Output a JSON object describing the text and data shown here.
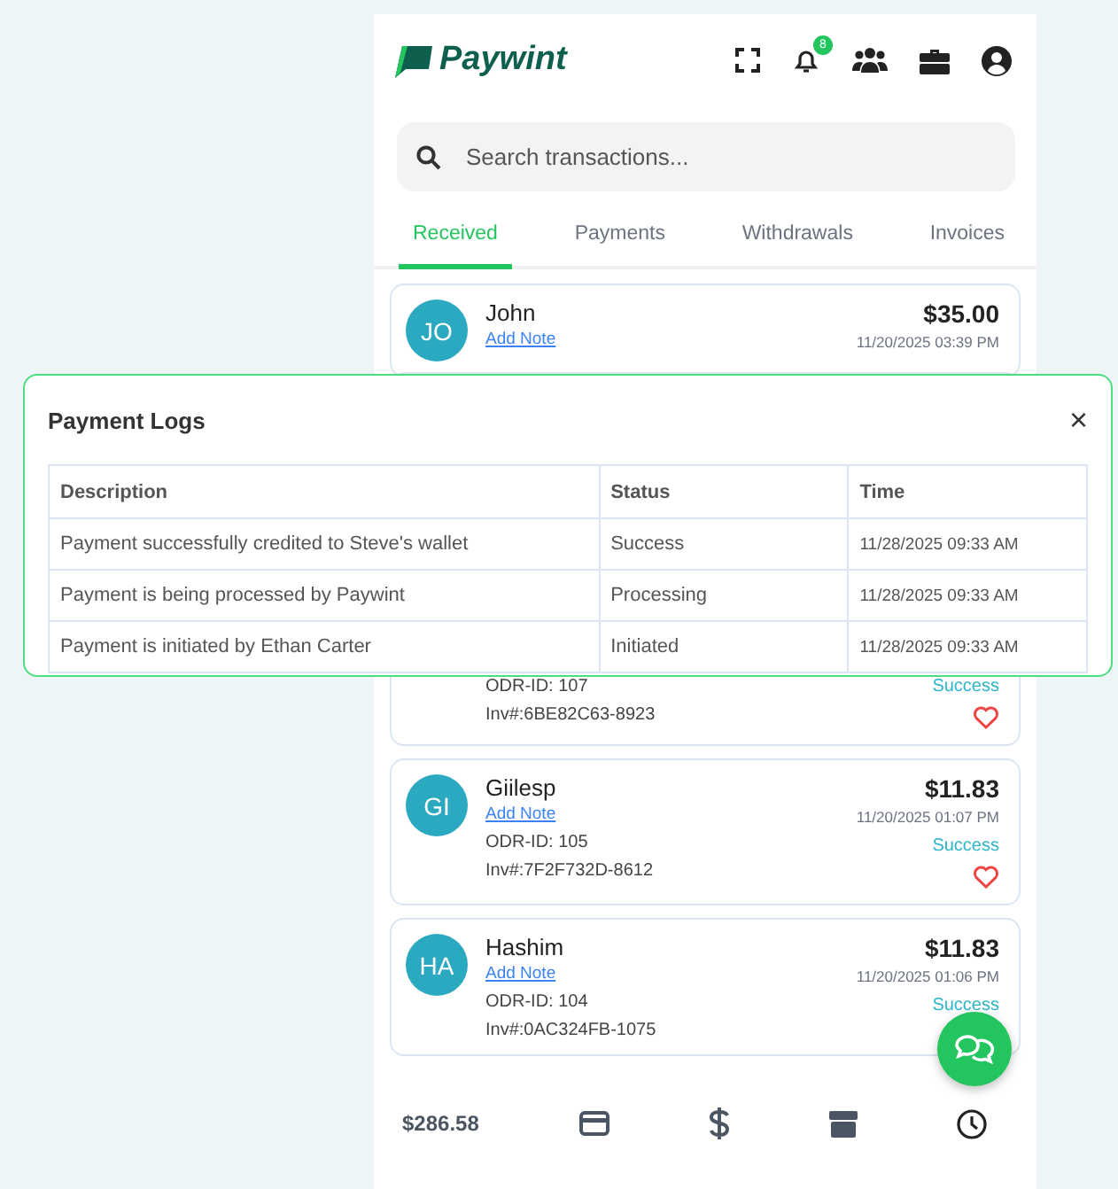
{
  "brand": {
    "name": "Paywint"
  },
  "header": {
    "notification_badge": "8"
  },
  "search": {
    "placeholder": "Search transactions..."
  },
  "tabs": [
    {
      "label": "Received",
      "selected": true
    },
    {
      "label": "Payments",
      "selected": false
    },
    {
      "label": "Withdrawals",
      "selected": false
    },
    {
      "label": "Invoices",
      "selected": false
    }
  ],
  "transactions": [
    {
      "initials": "JO",
      "name": "John",
      "note_link": "Add Note",
      "amount": "$35.00",
      "date": "11/20/2025 03:39 PM"
    },
    {
      "odr_id": "ODR-ID: 107",
      "invoice": "Inv#:6BE82C63-8923",
      "status": "Success",
      "favorite": false
    },
    {
      "initials": "GI",
      "name": "Giilesp",
      "note_link": "Add Note",
      "amount": "$11.83",
      "date": "11/20/2025 01:07 PM",
      "odr_id": "ODR-ID: 105",
      "invoice": "Inv#:7F2F732D-8612",
      "status": "Success",
      "favorite": false
    },
    {
      "initials": "HA",
      "name": "Hashim",
      "note_link": "Add Note",
      "amount": "$11.83",
      "date": "11/20/2025 01:06 PM",
      "odr_id": "ODR-ID: 104",
      "invoice": "Inv#:0AC324FB-1075",
      "status": "Success"
    }
  ],
  "bottom_bar": {
    "balance": "$286.58"
  },
  "modal": {
    "title": "Payment Logs",
    "close": "×",
    "columns": [
      "Description",
      "Status",
      "Time"
    ],
    "rows": [
      [
        "Payment successfully credited to Steve's wallet",
        "Success",
        "11/28/2025 09:33 AM"
      ],
      [
        "Payment is being processed by Paywint",
        "Processing",
        "11/28/2025 09:33 AM"
      ],
      [
        "Payment is initiated by Ethan Carter",
        "Initiated",
        "11/28/2025 09:33 AM"
      ]
    ]
  }
}
